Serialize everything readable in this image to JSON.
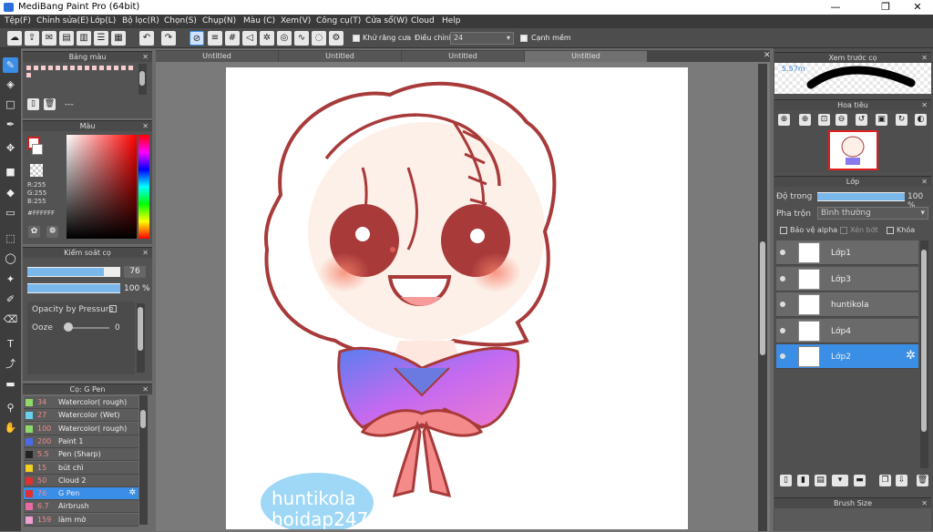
{
  "window": {
    "title": "MediBang Paint Pro (64bit)",
    "minimize": "—",
    "restore": "❐",
    "close": "✕"
  },
  "menu": [
    "Tệp(F)",
    "Chỉnh sửa(E)",
    "Lớp(L)",
    "Bộ lọc(R)",
    "Chọn(S)",
    "Chụp(N)",
    "Màu (C)",
    "Xem(V)",
    "Công cụ(T)",
    "Cửa sổ(W)",
    "Cloud",
    "Help"
  ],
  "toolbar": {
    "antialias_label": "Khử răng cưa",
    "adjust_label": "Điều chỉnh",
    "adjust_value": "24",
    "smooth_label": "Cạnh mềm"
  },
  "palette_panel": {
    "title": "Bảng màu",
    "dash": "---"
  },
  "color_panel": {
    "title": "Màu",
    "r": "R:255",
    "g": "G:255",
    "b": "B:255",
    "hex": "#FFFFFF"
  },
  "brush_control": {
    "title": "Kiểm soát cọ",
    "size": "76",
    "opacity": "100 %",
    "opacity_pressure": "Opacity by Pressure",
    "ooze_label": "Ooze",
    "ooze_value": "0",
    "size_level": 0.82,
    "opacity_level": 1.0
  },
  "brush_list": {
    "title": "Cọ: G Pen",
    "items": [
      {
        "size": "34",
        "name": "Watercolor( rough)",
        "color": "#8fd86a"
      },
      {
        "size": "27",
        "name": "Watercolor (Wet)",
        "color": "#6ad0f0"
      },
      {
        "size": "100",
        "name": "Watercolor( rough)",
        "color": "#8fd86a"
      },
      {
        "size": "200",
        "name": "Paint 1",
        "color": "#4a6ae8"
      },
      {
        "size": "5.5",
        "name": "Pen (Sharp)",
        "color": "#222222"
      },
      {
        "size": "15",
        "name": "bút chì",
        "color": "#f0d020"
      },
      {
        "size": "50",
        "name": "Cloud 2",
        "color": "#e03030"
      },
      {
        "size": "76",
        "name": "G Pen",
        "color": "#e03030",
        "selected": true
      },
      {
        "size": "6.7",
        "name": "Airbrush",
        "color": "#e86aa0"
      },
      {
        "size": "159",
        "name": "làm mờ",
        "color": "#f0a0d0"
      }
    ]
  },
  "tabs": [
    "Untitled",
    "Untitled",
    "Untitled",
    "Untitled"
  ],
  "watermark": {
    "line1": "huntikola",
    "line2": "hoidap247"
  },
  "preview_panel": {
    "title": "Xem trước cọ",
    "size": "5.57m"
  },
  "navigator_panel": {
    "title": "Hoa tiêu"
  },
  "layer_panel": {
    "title": "Lớp",
    "opacity_label": "Độ trong",
    "opacity_value": "100 %",
    "blend_label": "Pha trộn",
    "blend_value": "Bình thường",
    "protect_alpha": "Bảo vệ alpha",
    "clip": "Xén bớt",
    "lock": "Khóa",
    "layers": [
      {
        "name": "Lớp1"
      },
      {
        "name": "Lớp3"
      },
      {
        "name": "huntikola"
      },
      {
        "name": "Lớp4"
      },
      {
        "name": "Lớp2",
        "selected": true
      }
    ]
  },
  "brush_size_panel": {
    "title": "Brush Size"
  }
}
